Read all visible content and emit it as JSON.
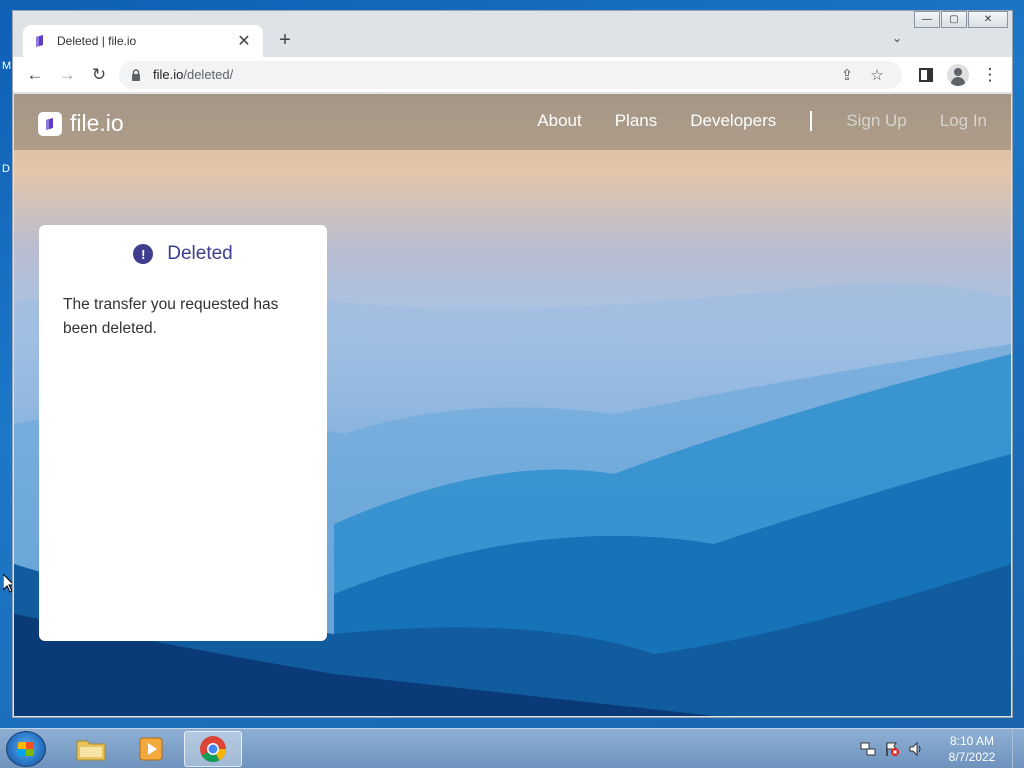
{
  "desktop": {
    "letters": [
      "M",
      "D"
    ]
  },
  "browser": {
    "tab": {
      "title": "Deleted | file.io",
      "close_glyph": "✕"
    },
    "new_tab_glyph": "+",
    "tab_search_glyph": "⌄",
    "window_controls": {
      "minimize": "—",
      "maximize": "▢",
      "close": "✕"
    },
    "toolbar": {
      "back_glyph": "←",
      "forward_glyph": "→",
      "reload_glyph": "↻",
      "url_host": "file.io",
      "url_path": "/deleted/",
      "share_glyph": "⇪",
      "bookmark_glyph": "☆",
      "menu_glyph": "⋮"
    }
  },
  "site": {
    "logo_text": "file.io",
    "nav": [
      "About",
      "Plans",
      "Developers"
    ],
    "auth": [
      "Sign Up",
      "Log In"
    ]
  },
  "card": {
    "icon_glyph": "!",
    "title": "Deleted",
    "message": "The transfer you requested has been deleted."
  },
  "taskbar": {
    "clock_time": "8:10 AM",
    "clock_date": "8/7/2022"
  },
  "colors": {
    "accent": "#3f3d8f",
    "logo_mark": "#5b3cc4"
  }
}
